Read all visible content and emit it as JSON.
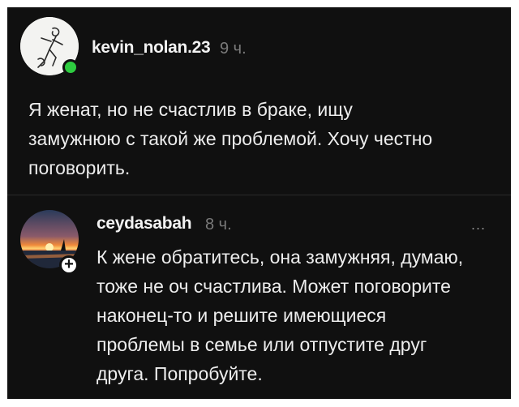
{
  "post": {
    "username": "kevin_nolan.23",
    "time": "9 ч.",
    "text_lines": [
      "Я женат, но не счастлив в браке, ищу",
      "замужнюю с такой же проблемой. Хочу честно",
      "поговорить."
    ]
  },
  "reply": {
    "username": "ceydasabah",
    "time": "8 ч.",
    "more_label": "...",
    "plus_label": "+",
    "text_lines": [
      "К жене обратитесь, она замужняя, думаю,",
      "тоже не оч счастлива. Может поговорите",
      "наконец-то и решите имеющиеся",
      "проблемы в семье или отпустите друг",
      "друга. Попробуйте."
    ]
  },
  "colors": {
    "background": "#101010",
    "text": "#ededed",
    "muted": "#7a7a7a",
    "online": "#2ecc40"
  },
  "icons": {
    "main_avatar": "sketch-figure-avatar",
    "reply_avatar": "sunset-photo-avatar",
    "online_indicator": "online-dot-icon",
    "follow": "plus-icon",
    "more": "ellipsis-icon"
  }
}
